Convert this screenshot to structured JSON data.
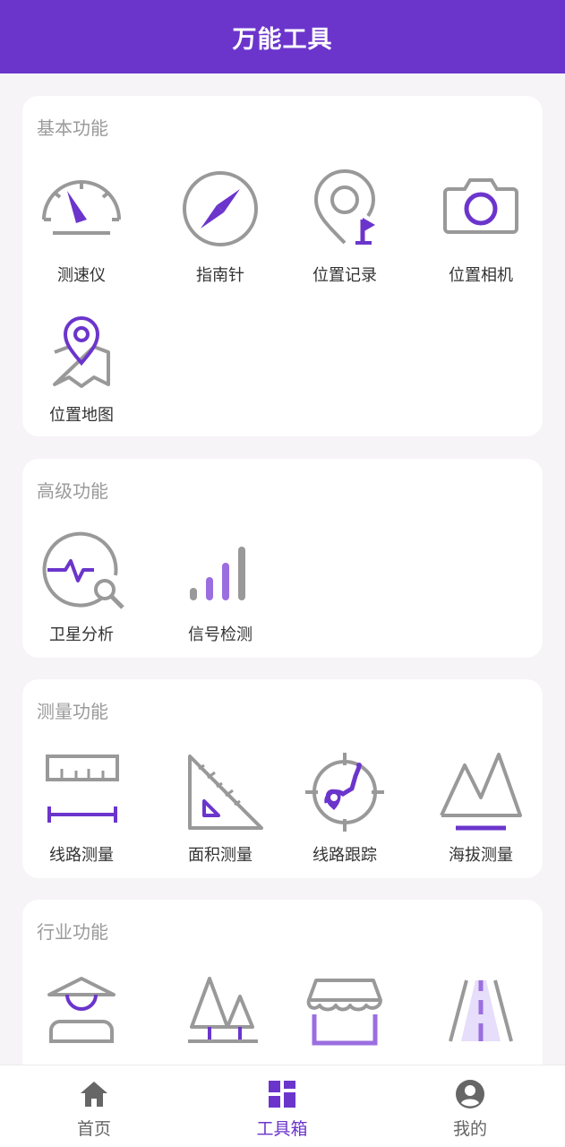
{
  "header": {
    "title": "万能工具"
  },
  "colors": {
    "accent": "#6b35cc",
    "icon_gray": "#999999",
    "icon_purple": "#6b35cc"
  },
  "sections": [
    {
      "title": "基本功能",
      "items": [
        {
          "label": "测速仪",
          "icon": "speedometer-icon"
        },
        {
          "label": "指南针",
          "icon": "compass-icon"
        },
        {
          "label": "位置记录",
          "icon": "location-record-icon"
        },
        {
          "label": "位置相机",
          "icon": "camera-icon"
        },
        {
          "label": "位置地图",
          "icon": "map-pin-icon"
        }
      ]
    },
    {
      "title": "高级功能",
      "items": [
        {
          "label": "卫星分析",
          "icon": "satellite-analysis-icon"
        },
        {
          "label": "信号检测",
          "icon": "signal-bars-icon"
        }
      ]
    },
    {
      "title": "测量功能",
      "items": [
        {
          "label": "线路测量",
          "icon": "ruler-icon"
        },
        {
          "label": "面积测量",
          "icon": "triangle-ruler-icon"
        },
        {
          "label": "线路跟踪",
          "icon": "route-track-icon"
        },
        {
          "label": "海拔测量",
          "icon": "mountain-icon"
        }
      ]
    },
    {
      "title": "行业功能",
      "items": [
        {
          "label": "",
          "icon": "farmer-icon"
        },
        {
          "label": "",
          "icon": "forest-icon"
        },
        {
          "label": "",
          "icon": "shop-icon"
        },
        {
          "label": "",
          "icon": "road-icon"
        }
      ]
    }
  ],
  "tabbar": {
    "tabs": [
      {
        "label": "首页",
        "icon": "home-icon",
        "active": false
      },
      {
        "label": "工具箱",
        "icon": "toolbox-grid-icon",
        "active": true
      },
      {
        "label": "我的",
        "icon": "user-icon",
        "active": false
      }
    ]
  }
}
